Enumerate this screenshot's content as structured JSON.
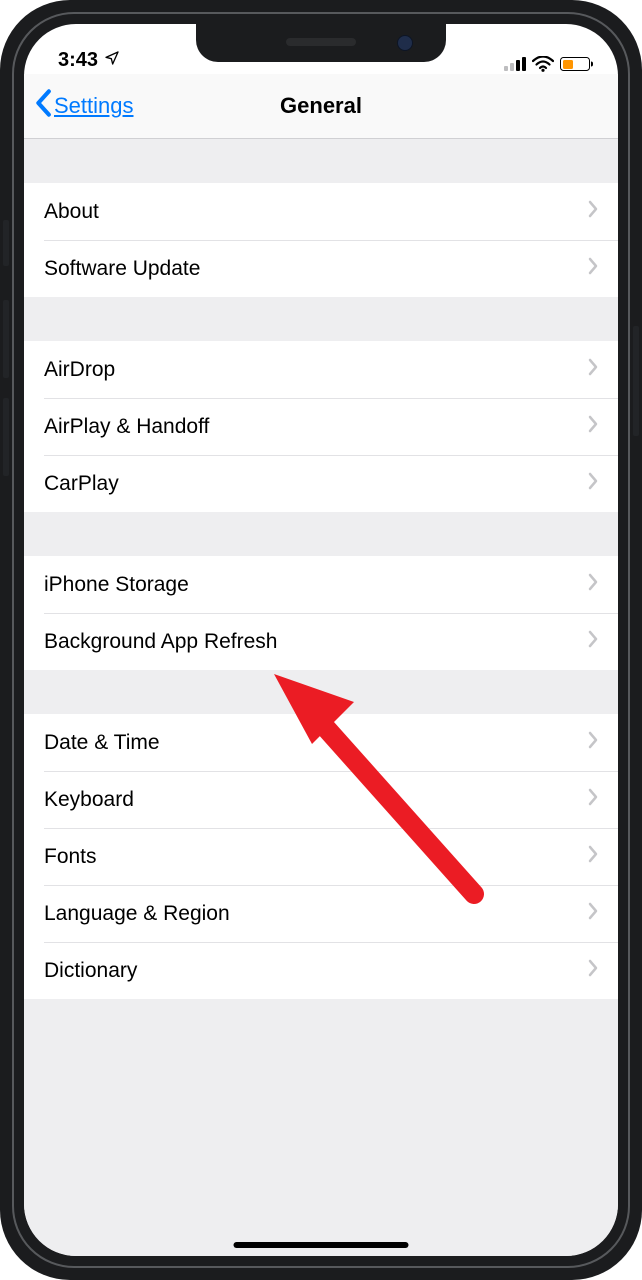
{
  "status_bar": {
    "time": "3:43"
  },
  "nav": {
    "back_label": "Settings",
    "title": "General"
  },
  "groups": [
    {
      "items": [
        {
          "key": "about",
          "label": "About"
        },
        {
          "key": "software-update",
          "label": "Software Update"
        }
      ]
    },
    {
      "items": [
        {
          "key": "airdrop",
          "label": "AirDrop"
        },
        {
          "key": "airplay-handoff",
          "label": "AirPlay & Handoff"
        },
        {
          "key": "carplay",
          "label": "CarPlay"
        }
      ]
    },
    {
      "items": [
        {
          "key": "iphone-storage",
          "label": "iPhone Storage"
        },
        {
          "key": "background-app-refresh",
          "label": "Background App Refresh"
        }
      ]
    },
    {
      "items": [
        {
          "key": "date-time",
          "label": "Date & Time"
        },
        {
          "key": "keyboard",
          "label": "Keyboard"
        },
        {
          "key": "fonts",
          "label": "Fonts"
        },
        {
          "key": "language-region",
          "label": "Language & Region"
        },
        {
          "key": "dictionary",
          "label": "Dictionary"
        }
      ]
    }
  ]
}
